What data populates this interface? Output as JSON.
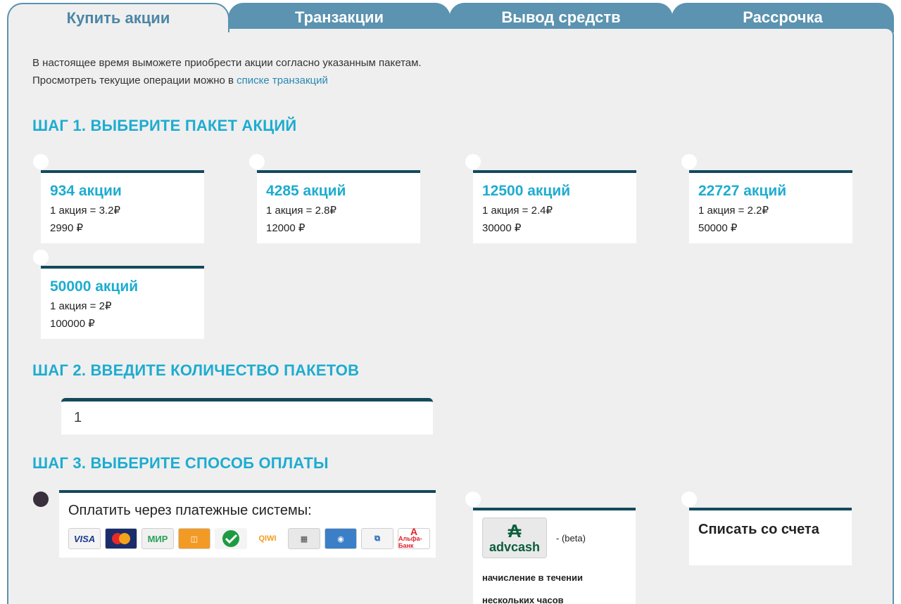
{
  "tabs": [
    {
      "label": "Купить акции",
      "active": true
    },
    {
      "label": "Транзакции",
      "active": false
    },
    {
      "label": "Вывод средств",
      "active": false
    },
    {
      "label": "Рассрочка",
      "active": false
    }
  ],
  "intro": {
    "line1": "В настоящее время выможете приобрести акции согласно указанным пакетам.",
    "line2_prefix": "Просмотреть текущие операции можно в ",
    "line2_link": "списке транзакций"
  },
  "step1": {
    "title": "ШАГ 1. ВЫБЕРИТЕ ПАКЕТ АКЦИЙ",
    "packages": [
      {
        "title": "934 акции",
        "rate": "1 акция = 3.2₽",
        "price": "2990 ₽"
      },
      {
        "title": "4285 акций",
        "rate": "1 акция = 2.8₽",
        "price": "12000 ₽"
      },
      {
        "title": "12500 акций",
        "rate": "1 акция = 2.4₽",
        "price": "30000 ₽"
      },
      {
        "title": "22727 акций",
        "rate": "1 акция = 2.2₽",
        "price": "50000 ₽"
      },
      {
        "title": "50000 акций",
        "rate": "1 акция = 2₽",
        "price": "100000 ₽"
      }
    ]
  },
  "step2": {
    "title": "ШАГ 2. ВВЕДИТЕ КОЛИЧЕСТВО ПАКЕТОВ",
    "quantity": "1"
  },
  "step3": {
    "title": "ШАГ 3. ВЫБЕРИТЕ СПОСОБ ОПЛАТЫ",
    "payment_systems": {
      "title": "Оплатить через платежные системы:",
      "logos": [
        "VISA",
        "MasterCard",
        "МИР",
        "Яндекс.Деньги",
        "Сбербанк",
        "QIWI",
        "Оплата",
        "WebMoney",
        "RP",
        "Альфа-Банк"
      ]
    },
    "advcash": {
      "logo_text": "advcash",
      "beta": "- (beta)",
      "note": "начисление в течении нескольких часов"
    },
    "account": {
      "title": "Списать со счета"
    }
  },
  "colors": {
    "accent": "#1eacd0",
    "tab": "#5b93b0",
    "card_border": "#124a5c",
    "panel_bg": "#efefef"
  }
}
